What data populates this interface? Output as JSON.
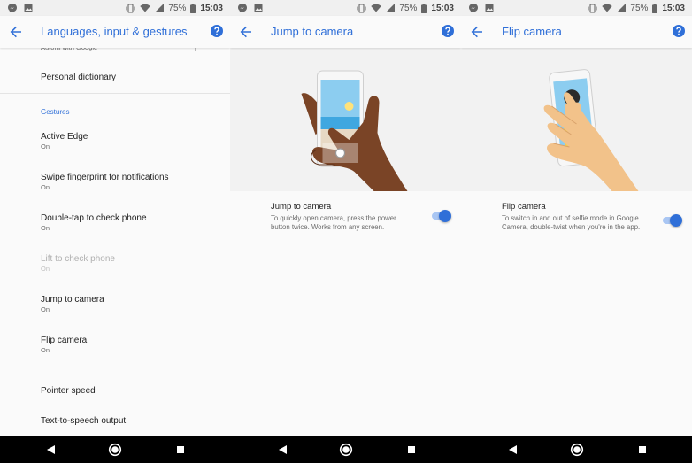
{
  "status_bar": {
    "battery": "75%",
    "time": "15:03"
  },
  "panel1": {
    "title": "Languages, input & gestures",
    "partial_item": "Autofill with Google",
    "items_top": [
      {
        "title": "Personal dictionary"
      }
    ],
    "section": "Gestures",
    "gestures": [
      {
        "title": "Active Edge",
        "subtitle": "On"
      },
      {
        "title": "Swipe fingerprint for notifications",
        "subtitle": "On"
      },
      {
        "title": "Double-tap to check phone",
        "subtitle": "On"
      },
      {
        "title": "Lift to check phone",
        "subtitle": "On",
        "disabled": true
      },
      {
        "title": "Jump to camera",
        "subtitle": "On"
      },
      {
        "title": "Flip camera",
        "subtitle": "On"
      }
    ],
    "items_bottom": [
      {
        "title": "Pointer speed"
      },
      {
        "title": "Text-to-speech output"
      }
    ]
  },
  "panel2": {
    "title": "Jump to camera",
    "setting_title": "Jump to camera",
    "setting_desc": "To quickly open camera, press the power button twice. Works from any screen.",
    "toggle_on": true
  },
  "panel3": {
    "title": "Flip camera",
    "setting_title": "Flip camera",
    "setting_desc": "To switch in and out of selfie mode in Google Camera, double-twist when you're in the app.",
    "toggle_on": true
  },
  "colors": {
    "accent": "#2f6fd8",
    "toggle_track": "#a9c6f3",
    "skin_dark": "#7a4426",
    "skin_light": "#f2c28a",
    "sky": "#8ccdf0"
  },
  "icons": {
    "back": "arrow-left-icon",
    "help": "help-circle-icon",
    "nav": [
      "back-triangle-icon",
      "home-circle-icon",
      "recents-square-icon"
    ]
  }
}
